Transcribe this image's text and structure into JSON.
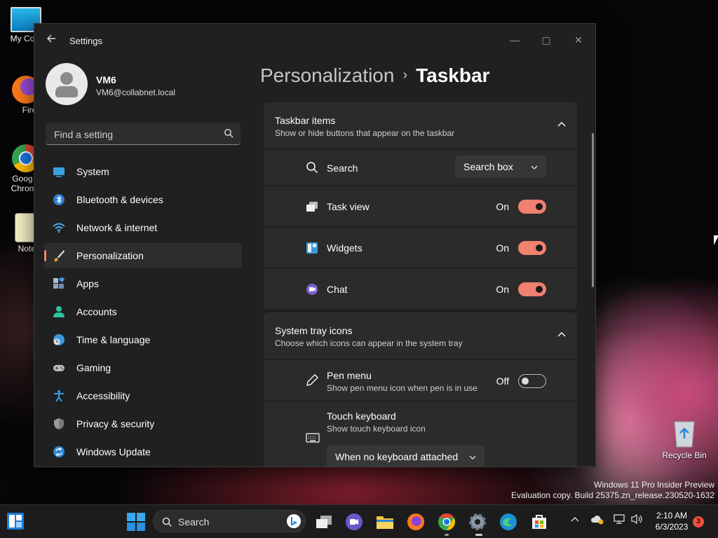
{
  "desktop": {
    "icons": [
      {
        "label": "My Com",
        "icon": "monitor-icon"
      },
      {
        "label": "Firefo",
        "icon": "firefox-icon"
      },
      {
        "label": "Goog Chron",
        "icon": "chrome-icon"
      },
      {
        "label": "Notepa",
        "icon": "notepad-icon"
      }
    ],
    "recycle_bin": "Recycle Bin",
    "watermark": {
      "line1": "Windows 11 Pro Insider Preview",
      "line2": "Evaluation copy. Build 25375.zn_release.230520-1632"
    }
  },
  "window": {
    "title": "Settings",
    "controls": {
      "minimize": "—",
      "maximize": "▢",
      "close": "✕"
    }
  },
  "profile": {
    "name": "VM6",
    "email": "VM6@collabnet.local"
  },
  "search": {
    "placeholder": "Find a setting"
  },
  "nav": {
    "items": [
      {
        "label": "System",
        "icon": "system-icon"
      },
      {
        "label": "Bluetooth & devices",
        "icon": "bluetooth-icon"
      },
      {
        "label": "Network & internet",
        "icon": "wifi-icon"
      },
      {
        "label": "Personalization",
        "icon": "brush-icon",
        "active": true
      },
      {
        "label": "Apps",
        "icon": "apps-icon"
      },
      {
        "label": "Accounts",
        "icon": "accounts-icon"
      },
      {
        "label": "Time & language",
        "icon": "clock-globe-icon"
      },
      {
        "label": "Gaming",
        "icon": "gamepad-icon"
      },
      {
        "label": "Accessibility",
        "icon": "accessibility-icon"
      },
      {
        "label": "Privacy & security",
        "icon": "shield-icon"
      },
      {
        "label": "Windows Update",
        "icon": "update-icon"
      }
    ]
  },
  "content": {
    "breadcrumb": {
      "parent": "Personalization",
      "sep": "›",
      "current": "Taskbar"
    },
    "taskbar_items": {
      "title": "Taskbar items",
      "subtitle": "Show or hide buttons that appear on the taskbar",
      "rows": {
        "search": {
          "label": "Search",
          "value": "Search box"
        },
        "task_view": {
          "label": "Task view",
          "state": "On"
        },
        "widgets": {
          "label": "Widgets",
          "state": "On"
        },
        "chat": {
          "label": "Chat",
          "state": "On"
        }
      }
    },
    "system_tray": {
      "title": "System tray icons",
      "subtitle": "Choose which icons can appear in the system tray",
      "rows": {
        "pen_menu": {
          "label": "Pen menu",
          "sub": "Show pen menu icon when pen is in use",
          "state": "Off"
        },
        "touch_keyboard": {
          "label": "Touch keyboard",
          "sub": "Show touch keyboard icon",
          "value": "When no keyboard attached"
        }
      }
    }
  },
  "taskbar": {
    "search_label": "Search",
    "clock_time": "2:10 AM",
    "clock_date": "6/3/2023",
    "notification_count": "3"
  },
  "colors": {
    "accent": "#f08070",
    "window_bg": "#202020",
    "card_bg": "#2b2b2b"
  }
}
